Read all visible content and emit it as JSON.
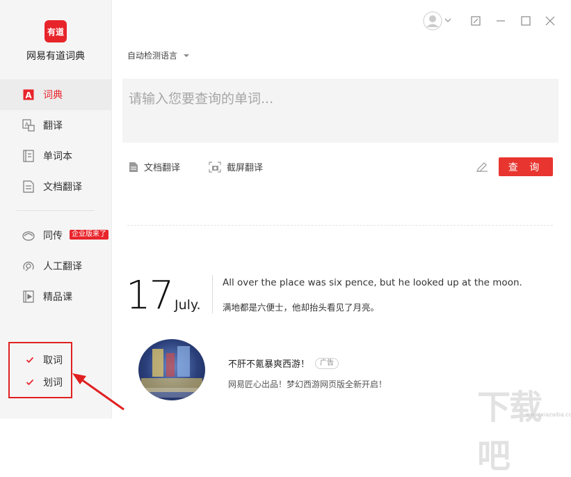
{
  "app": {
    "logo_text": "有道",
    "name": "网易有道词典"
  },
  "sidebar": {
    "items": [
      {
        "label": "词典",
        "icon": "dictionary-icon",
        "active": true
      },
      {
        "label": "翻译",
        "icon": "translate-icon"
      },
      {
        "label": "单词本",
        "icon": "wordbook-icon"
      },
      {
        "label": "文档翻译",
        "icon": "document-icon"
      },
      {
        "label": "同传",
        "icon": "simultaneous-icon",
        "badge": "企业版来了"
      },
      {
        "label": "人工翻译",
        "icon": "human-translate-icon"
      },
      {
        "label": "精品课",
        "icon": "course-icon"
      }
    ],
    "options": [
      {
        "label": "取词",
        "checked": true
      },
      {
        "label": "划词",
        "checked": true
      }
    ]
  },
  "main": {
    "language_select": "自动检测语言",
    "search_placeholder": "请输入您要查询的单词...",
    "tools": {
      "doc_translate": "文档翻译",
      "screenshot_translate": "截屏翻译"
    },
    "query_button": "查 询"
  },
  "daily": {
    "day": "17",
    "month": "July.",
    "sentence_en": "All over the place was six pence, but he looked up at the moon.",
    "sentence_cn": "满地都是六便士，他却抬头看见了月亮。"
  },
  "ad": {
    "title": "不肝不氪暴爽西游！",
    "tag": "广告",
    "description": "网易匠心出品！梦幻西游网页版全新开启！"
  },
  "watermark": {
    "text": "下载吧",
    "url": "www.xiazaiba.com"
  },
  "colors": {
    "accent": "#e8242b",
    "sidebar_bg": "#f5f5f5",
    "search_bg": "#f4f4f4",
    "annotation": "#e02020"
  }
}
